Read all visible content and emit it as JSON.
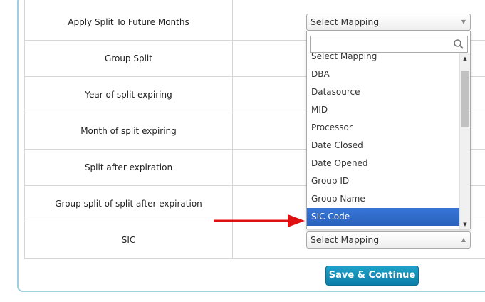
{
  "rows": [
    {
      "label": "Apply Split To Future Months"
    },
    {
      "label": "Group Split"
    },
    {
      "label": "Year of split expiring"
    },
    {
      "label": "Month of split expiring"
    },
    {
      "label": "Split after expiration"
    },
    {
      "label": "Group split of split after expiration"
    },
    {
      "label": "SIC"
    }
  ],
  "selects": {
    "top": {
      "value": "Select Mapping"
    },
    "sic": {
      "value": "Select Mapping"
    }
  },
  "dropdown": {
    "search_value": "",
    "options": [
      "Select Mapping",
      "DBA",
      "Datasource",
      "MID",
      "Processor",
      "Date Closed",
      "Date Opened",
      "Group ID",
      "Group Name",
      "SIC Code"
    ],
    "highlighted": "SIC Code"
  },
  "actions": {
    "save_label": "Save & Continue"
  },
  "colors": {
    "highlight": "#3875d7",
    "button": "#1390bb",
    "annotation_arrow": "#e01010"
  },
  "icons": {
    "search": "search-icon",
    "arrow": "red-arrow-annotation"
  }
}
